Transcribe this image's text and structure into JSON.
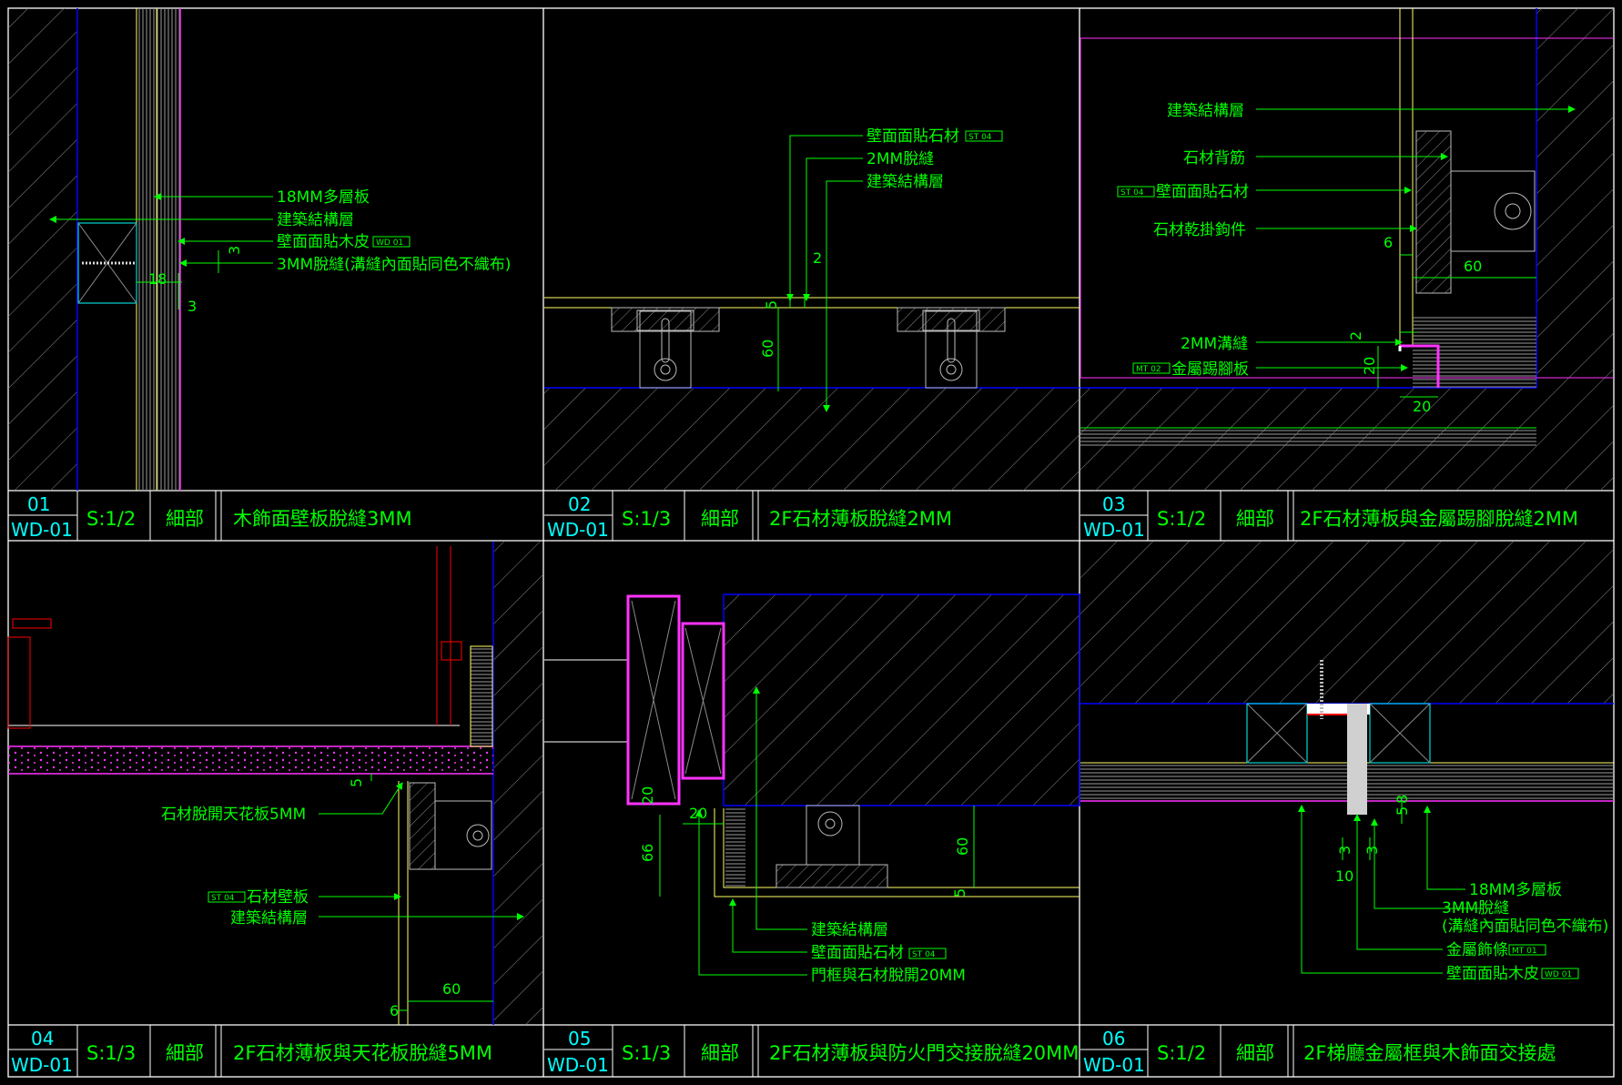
{
  "colors": {
    "background": "#000000",
    "annotation": "#00ff00",
    "frame": "#ffffff",
    "detail_number": "#00ffff",
    "structure": "#0000ff",
    "panel": "#ffff66",
    "metal": "#ff33ff",
    "existing": "#ff0000"
  },
  "details": [
    {
      "no": "01",
      "sheet": "WD-01",
      "scale": "S:1/2",
      "kind": "細部",
      "title": "木飾面壁板脫縫3MM",
      "labels": {
        "l1": "18MM多層板",
        "l2": "建築結構層",
        "l3": "壁面面貼木皮",
        "l3_tag": "WD 01",
        "l4": "3MM脫縫(溝縫內面貼同色不織布)"
      },
      "dims": {
        "d3a": "3",
        "d18": "18",
        "d3b": "3"
      }
    },
    {
      "no": "02",
      "sheet": "WD-01",
      "scale": "S:1/3",
      "kind": "細部",
      "title": "2F石材薄板脫縫2MM",
      "labels": {
        "l1": "壁面面貼石材",
        "l1_tag": "ST 04",
        "l2": "2MM脫縫",
        "l3": "建築結構層"
      },
      "dims": {
        "d2": "2",
        "d5": "5",
        "d60": "60"
      }
    },
    {
      "no": "03",
      "sheet": "WD-01",
      "scale": "S:1/2",
      "kind": "細部",
      "title": "2F石材薄板與金屬踢腳脫縫2MM",
      "labels": {
        "l1": "建築結構層",
        "l2": "石材背筋",
        "l3": "壁面面貼石材",
        "l3_tag": "ST 04",
        "l4": "石材乾掛鉤件",
        "l5": "2MM溝縫",
        "l6": "金屬踢腳板",
        "l6_tag": "MT 02"
      },
      "dims": {
        "d6": "6",
        "d60": "60",
        "d2": "2",
        "d20a": "20",
        "d20b": "20"
      }
    },
    {
      "no": "04",
      "sheet": "WD-01",
      "scale": "S:1/3",
      "kind": "細部",
      "title": "2F石材薄板與天花板脫縫5MM",
      "labels": {
        "l1": "石材脫開天花板5MM",
        "l2": "石材壁板",
        "l2_tag": "ST 04",
        "l3": "建築結構層"
      },
      "dims": {
        "d5": "5",
        "d60": "60",
        "d6": "6"
      }
    },
    {
      "no": "05",
      "sheet": "WD-01",
      "scale": "S:1/3",
      "kind": "細部",
      "title": "2F石材薄板與防火門交接脫縫20MM",
      "labels": {
        "l1": "建築結構層",
        "l2": "壁面面貼石材",
        "l2_tag": "ST 04",
        "l3": "門框與石材脫開20MM"
      },
      "dims": {
        "d20a": "20",
        "d20b": "20",
        "d66": "66",
        "d60": "60",
        "d5": "5"
      }
    },
    {
      "no": "06",
      "sheet": "WD-01",
      "scale": "S:1/2",
      "kind": "細部",
      "title": "2F梯廳金屬框與木飾面交接處",
      "labels": {
        "l1": "18MM多層板",
        "l2a": "3MM脫縫",
        "l2b": "(溝縫內面貼同色不織布)",
        "l3": "金屬飾條",
        "l3_tag": "MT 01",
        "l4": "壁面面貼木皮",
        "l4_tag": "WD 01"
      },
      "dims": {
        "d3a": "3",
        "d3b": "3",
        "d10": "10",
        "d5": "5",
        "d8": "8"
      }
    }
  ]
}
